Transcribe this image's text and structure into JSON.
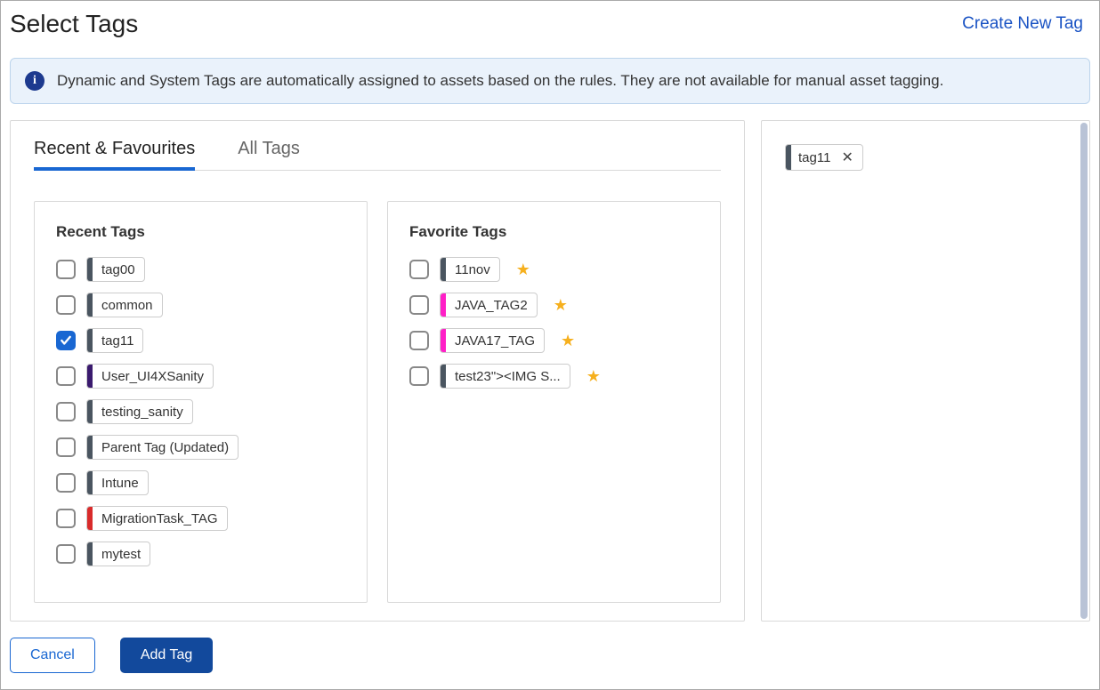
{
  "header": {
    "title": "Select Tags",
    "create_link": "Create New Tag"
  },
  "info": {
    "text": "Dynamic and System Tags are automatically assigned to assets based on the rules. They are not available for manual asset tagging."
  },
  "tabs": {
    "recent": "Recent & Favourites",
    "all": "All Tags"
  },
  "recent": {
    "title": "Recent Tags",
    "items": [
      {
        "label": "tag00",
        "color": "#4a5560",
        "checked": false
      },
      {
        "label": "common",
        "color": "#4a5560",
        "checked": false
      },
      {
        "label": "tag11",
        "color": "#4a5560",
        "checked": true
      },
      {
        "label": "User_UI4XSanity",
        "color": "#3a1a6e",
        "checked": false
      },
      {
        "label": "testing_sanity",
        "color": "#4a5560",
        "checked": false
      },
      {
        "label": "Parent Tag (Updated)",
        "color": "#4a5560",
        "checked": false
      },
      {
        "label": "Intune",
        "color": "#4a5560",
        "checked": false
      },
      {
        "label": "MigrationTask_TAG",
        "color": "#d92b2b",
        "checked": false
      },
      {
        "label": "mytest",
        "color": "#4a5560",
        "checked": false
      }
    ]
  },
  "favorite": {
    "title": "Favorite Tags",
    "items": [
      {
        "label": "11nov",
        "color": "#4a5560"
      },
      {
        "label": "JAVA_TAG2",
        "color": "#ff1fc7"
      },
      {
        "label": "JAVA17_TAG",
        "color": "#ff1fc7"
      },
      {
        "label": "test23\"><IMG S...",
        "color": "#4a5560"
      }
    ]
  },
  "selected": {
    "items": [
      {
        "label": "tag11",
        "color": "#4a5560"
      }
    ]
  },
  "footer": {
    "cancel": "Cancel",
    "add": "Add Tag"
  }
}
